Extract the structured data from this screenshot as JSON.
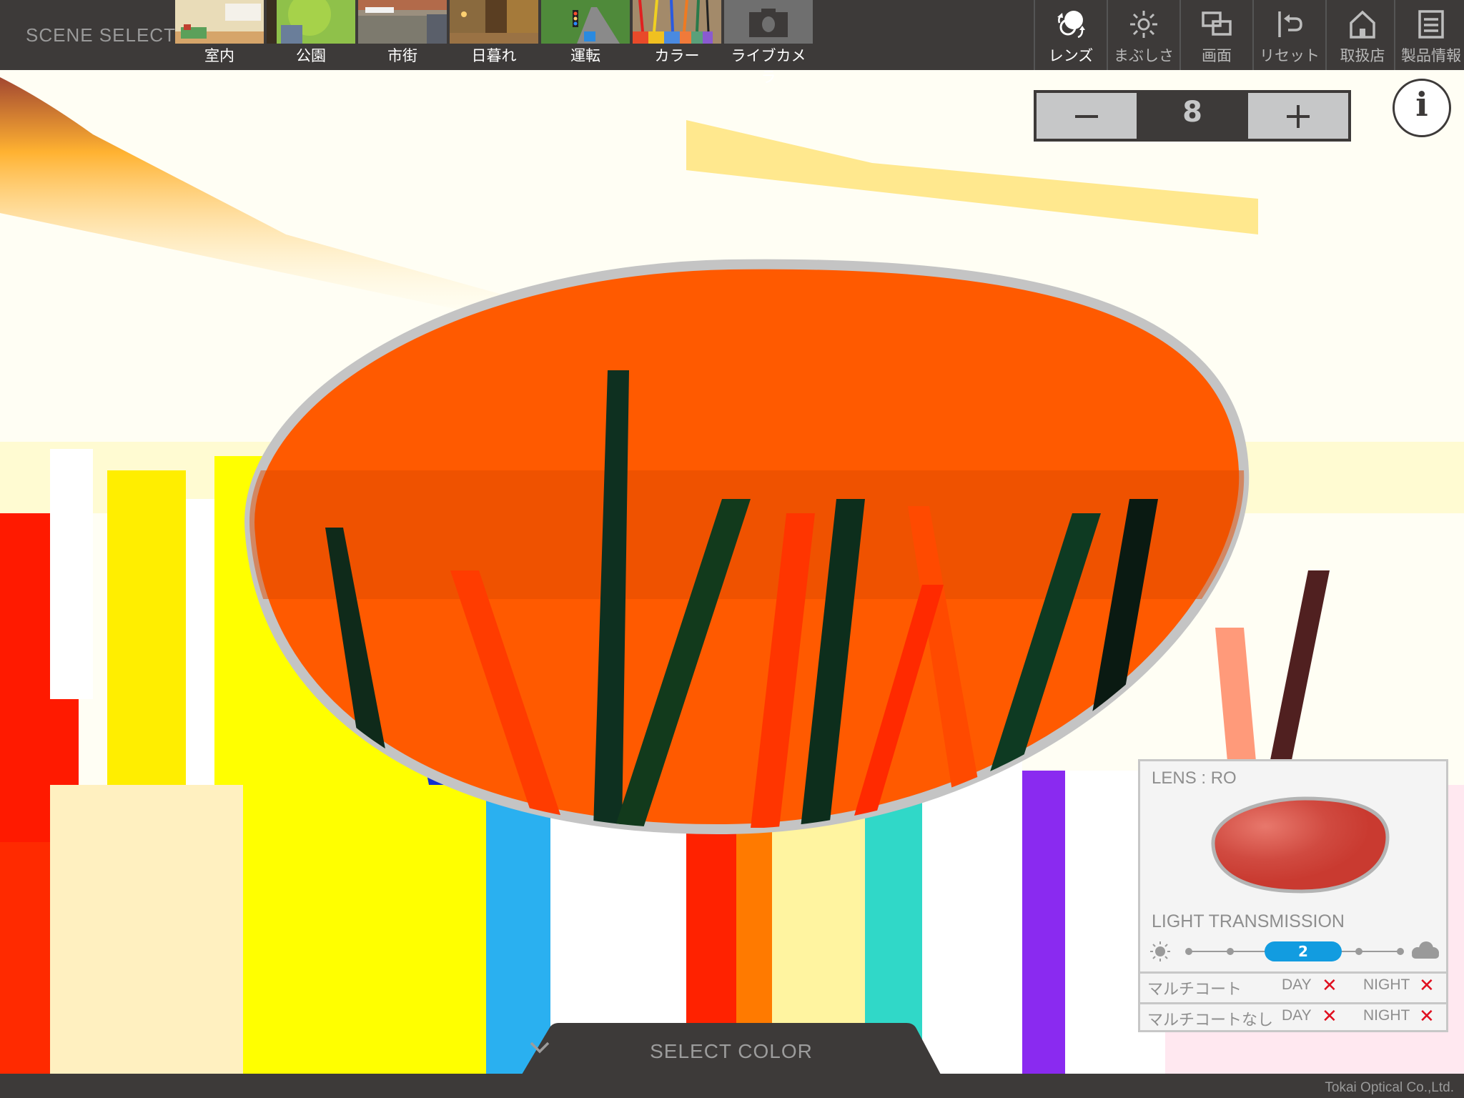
{
  "header": {
    "scene_select_label": "SCENE SELECT",
    "scenes": [
      {
        "label": "室内",
        "thumb": "indoor-room"
      },
      {
        "label": "公園",
        "thumb": "park-trees"
      },
      {
        "label": "市街",
        "thumb": "city-street"
      },
      {
        "label": "日暮れ",
        "thumb": "dusk-street"
      },
      {
        "label": "運転",
        "thumb": "driving-road"
      },
      {
        "label": "カラー",
        "thumb": "colored-pencils"
      },
      {
        "label": "ライブカメラ",
        "thumb": "camera-icon"
      }
    ],
    "tools": [
      {
        "label": "レンズ",
        "icon": "lens-swap-icon",
        "active": true
      },
      {
        "label": "まぶしさ",
        "icon": "sun-icon",
        "active": false
      },
      {
        "label": "画面",
        "icon": "screen-split-icon",
        "active": false
      },
      {
        "label": "リセット",
        "icon": "reset-icon",
        "active": false
      },
      {
        "label": "取扱店",
        "icon": "home-icon",
        "active": false
      },
      {
        "label": "製品情報",
        "icon": "document-icon",
        "active": false
      }
    ]
  },
  "stepper": {
    "minus_label": "−",
    "value": "8",
    "plus_label": "+"
  },
  "info_label": "i",
  "lens_panel": {
    "lens_title": "LENS : RO",
    "lens_color": "#c93a30",
    "light_transmission_title": "LIGHT TRANSMISSION",
    "transmission_levels": 5,
    "transmission_value": "2",
    "rows": [
      {
        "name": "マルチコート",
        "day_label": "DAY",
        "day_mark": "✕",
        "night_label": "NIGHT",
        "night_mark": "✕"
      },
      {
        "name": "マルチコートなし",
        "day_label": "DAY",
        "day_mark": "✕",
        "night_label": "NIGHT",
        "night_mark": "✕"
      }
    ]
  },
  "select_color_label": "SELECT  COLOR",
  "copyright": "Tokai Optical Co.,Ltd.",
  "colors": {
    "bar": "#3d3a39",
    "lens_tint": "#ff5a00",
    "slider_accent": "#129ce0",
    "mark_red": "#e01020"
  }
}
